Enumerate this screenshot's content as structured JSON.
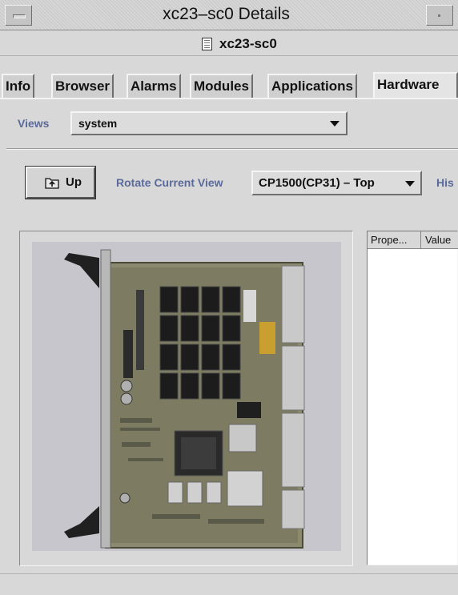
{
  "window": {
    "title": "xc23–sc0 Details"
  },
  "header": {
    "host_name": "xc23-sc0",
    "host_icon": "server-icon"
  },
  "tabs": [
    {
      "label": "Info",
      "active": false
    },
    {
      "label": "Browser",
      "active": false
    },
    {
      "label": "Alarms",
      "active": false
    },
    {
      "label": "Modules",
      "active": false
    },
    {
      "label": "Applications",
      "active": false
    },
    {
      "label": "Hardware",
      "active": true
    }
  ],
  "views": {
    "label": "Views",
    "selected": "system"
  },
  "toolbar": {
    "up_label": "Up",
    "up_icon": "folder-up-icon",
    "rotate_label": "Rotate Current View",
    "rotate_selected": "CP1500(CP31) – Top",
    "history_label": "His"
  },
  "property_table": {
    "columns": [
      "Prope...",
      "Value"
    ]
  },
  "colors": {
    "label_blue": "#5a6a9a",
    "background": "#d8d8d8"
  }
}
